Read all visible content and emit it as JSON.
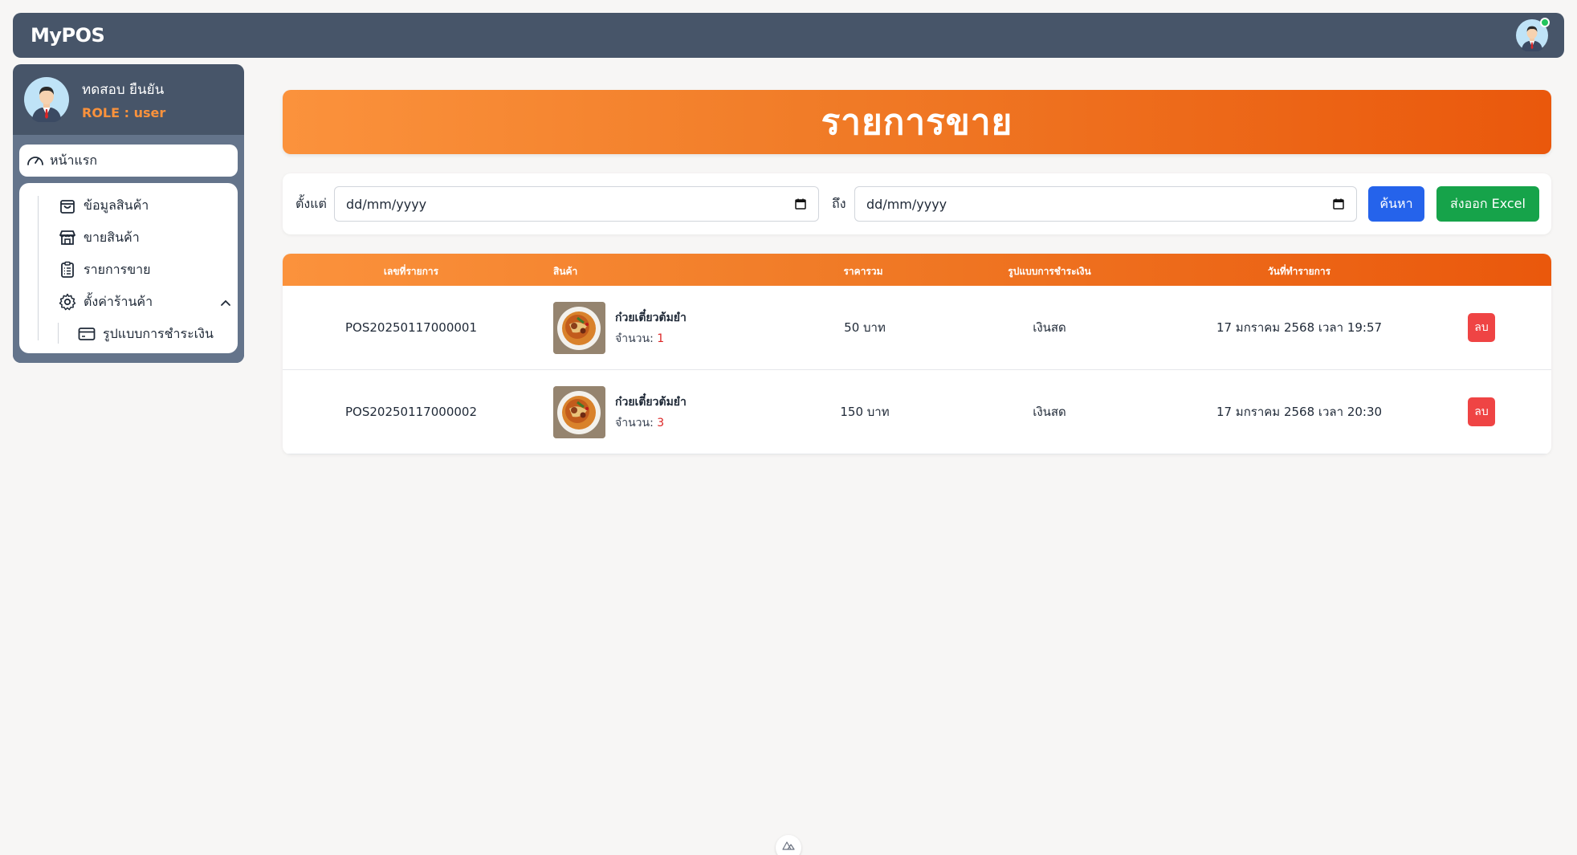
{
  "app": {
    "brand": "MyPOS"
  },
  "user": {
    "name": "ทดสอบ ยืนยัน",
    "role": "ROLE : user",
    "status_color": "#22c55e"
  },
  "sidebar": {
    "home": {
      "label": "หน้าแรก",
      "icon": "gauge-icon"
    },
    "items": [
      {
        "label": "ข้อมูลสินค้า",
        "icon": "shopping-bag-icon"
      },
      {
        "label": "ขายสินค้า",
        "icon": "store-icon"
      },
      {
        "label": "รายการขาย",
        "icon": "clipboard-list-icon"
      },
      {
        "label": "ตั้งค่าร้านค้า",
        "icon": "gear-icon",
        "expanded": true
      }
    ],
    "sub_items": [
      {
        "label": "รูปแบบการชำระเงิน",
        "icon": "credit-card-icon"
      }
    ]
  },
  "page": {
    "title": "รายการขาย"
  },
  "filter": {
    "from_label": "ตั้งแต่",
    "from_value": "dd/mm/yyyy",
    "to_label": "ถึง",
    "to_value": "dd/mm/yyyy",
    "search_label": "ค้นหา",
    "export_label": "ส่งออก Excel"
  },
  "table": {
    "headers": [
      "เลขที่รายการ",
      "สินค้า",
      "ราคารวม",
      "รูปแบบการชำระเงิน",
      "วันที่ทำรายการ"
    ],
    "qty_label": "จำนวน:",
    "delete_label": "ลบ",
    "rows": [
      {
        "order_no": "POS20250117000001",
        "product": "ก๋วยเตี๋ยวต้มยำ",
        "qty": "1",
        "total": "50 บาท",
        "payment": "เงินสด",
        "date": "17 มกราคม 2568 เวลา 19:57"
      },
      {
        "order_no": "POS20250117000002",
        "product": "ก๋วยเตี๋ยวต้มยำ",
        "qty": "3",
        "total": "150 บาท",
        "payment": "เงินสด",
        "date": "17 มกราคม 2568 เวลา 20:30"
      }
    ]
  },
  "colors": {
    "primary": "#475569",
    "accent": "#f97316",
    "search": "#2563eb",
    "export": "#16a34a",
    "delete": "#ef4444"
  }
}
